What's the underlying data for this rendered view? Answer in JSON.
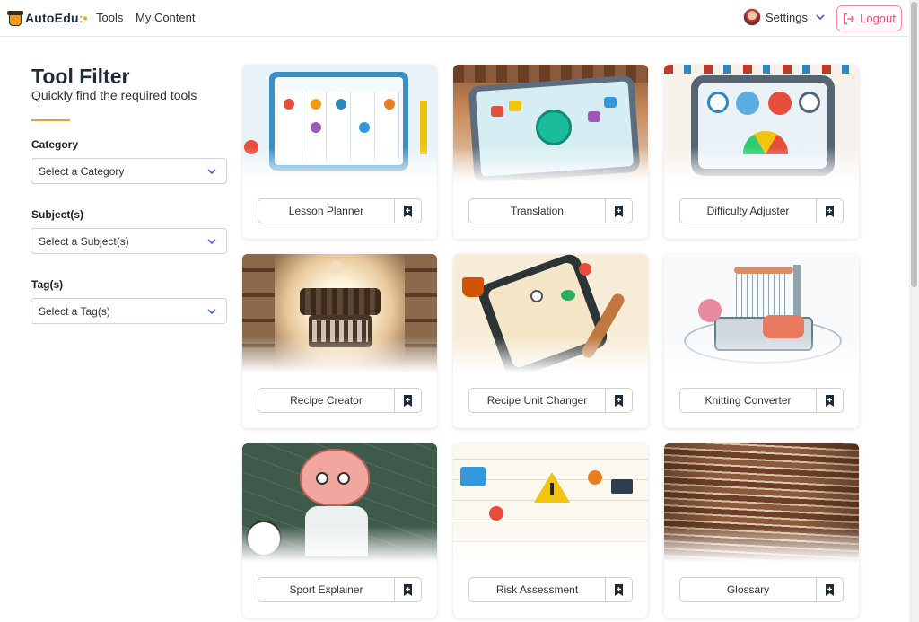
{
  "nav": {
    "brand": "AutoEdu",
    "links": [
      "Tools",
      "My Content"
    ],
    "settings_label": "Settings",
    "logout_label": "Logout"
  },
  "sidebar": {
    "title": "Tool Filter",
    "subtitle": "Quickly find the required tools",
    "filters": [
      {
        "label": "Category",
        "placeholder": "Select a Category"
      },
      {
        "label": "Subject(s)",
        "placeholder": "Select a Subject(s)"
      },
      {
        "label": "Tag(s)",
        "placeholder": "Select a Tag(s)"
      }
    ]
  },
  "tools": [
    {
      "name": "Lesson Planner",
      "image": "lesson-planner-illustration"
    },
    {
      "name": "Translation",
      "image": "translation-illustration"
    },
    {
      "name": "Difficulty Adjuster",
      "image": "difficulty-adjuster-illustration"
    },
    {
      "name": "Recipe Creator",
      "image": "recipe-creator-illustration"
    },
    {
      "name": "Recipe Unit Changer",
      "image": "recipe-unit-changer-illustration"
    },
    {
      "name": "Knitting Converter",
      "image": "knitting-converter-illustration"
    },
    {
      "name": "Sport Explainer",
      "image": "sport-explainer-illustration"
    },
    {
      "name": "Risk Assessment",
      "image": "risk-assessment-illustration"
    },
    {
      "name": "Glossary",
      "image": "glossary-illustration"
    }
  ],
  "colors": {
    "accent": "#e8a13a",
    "logout": "#e8486a",
    "brand_orange": "#f39c12"
  }
}
